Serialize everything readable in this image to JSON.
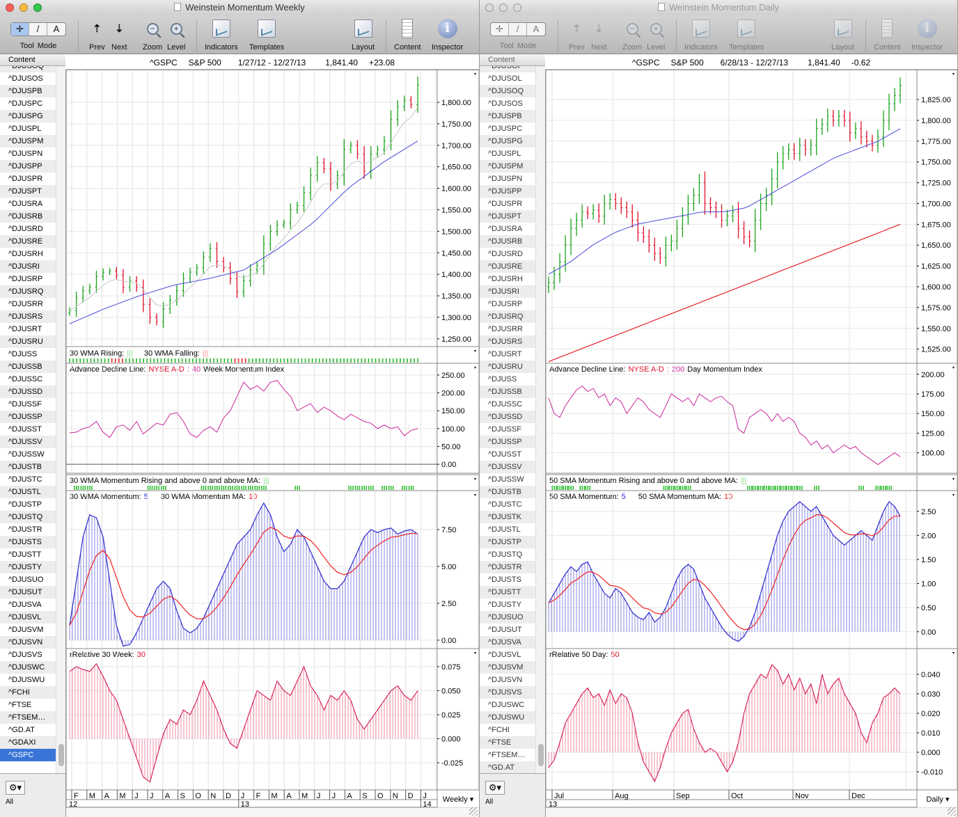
{
  "windows": [
    {
      "title": "Weinstein Momentum Weekly",
      "toolbar": {
        "tool_mode": "Tool Mode",
        "tool_cross": "✛",
        "tool_line": "/",
        "tool_text": "A",
        "prev": "Prev",
        "next": "Next",
        "zoom": "Zoom",
        "level": "Level",
        "indicators": "Indicators",
        "templates": "Templates",
        "layout": "Layout",
        "content": "Content",
        "inspector": "Inspector"
      },
      "sidebar": {
        "header": "Content",
        "filter": "All",
        "selected": "^GSPC",
        "items": [
          "^DJUSOQ",
          "^DJUSOS",
          "^DJUSPB",
          "^DJUSPC",
          "^DJUSPG",
          "^DJUSPL",
          "^DJUSPM",
          "^DJUSPN",
          "^DJUSPP",
          "^DJUSPR",
          "^DJUSPT",
          "^DJUSRA",
          "^DJUSRB",
          "^DJUSRD",
          "^DJUSRE",
          "^DJUSRH",
          "^DJUSRI",
          "^DJUSRP",
          "^DJUSRQ",
          "^DJUSRR",
          "^DJUSRS",
          "^DJUSRT",
          "^DJUSRU",
          "^DJUSS",
          "^DJUSSB",
          "^DJUSSC",
          "^DJUSSD",
          "^DJUSSF",
          "^DJUSSP",
          "^DJUSST",
          "^DJUSSV",
          "^DJUSSW",
          "^DJUSTB",
          "^DJUSTC",
          "^DJUSTL",
          "^DJUSTP",
          "^DJUSTQ",
          "^DJUSTR",
          "^DJUSTS",
          "^DJUSTT",
          "^DJUSTY",
          "^DJUSUO",
          "^DJUSUT",
          "^DJUSVA",
          "^DJUSVL",
          "^DJUSVM",
          "^DJUSVN",
          "^DJUSVS",
          "^DJUSWC",
          "^DJUSWU",
          "^FCHI",
          "^FTSE",
          "^FTSEM…",
          "^GD.AT",
          "^GDAXI",
          "^GSPC"
        ]
      },
      "header": {
        "symbol": "^GSPC",
        "name": "S&P 500",
        "range": "1/27/12 - 12/27/13",
        "last": "1,841.40",
        "change": "+23.08"
      },
      "legends": {
        "trend": {
          "rising_label": "30 WMA Rising:",
          "rising_mark": "|||",
          "falling_label": "30 WMA Falling:",
          "falling_mark": "|||"
        },
        "ad": {
          "label": "Advance Decline Line:",
          "series": "NYSE A-D",
          "sep": ":",
          "period": "40",
          "index": "Week Momentum Index"
        },
        "momrise": {
          "label": "30 WMA Momentum Rising and above 0 and above MA:",
          "mark": "|||"
        },
        "mom": {
          "label": "30 WMA Momentum:",
          "period": "5",
          "ma_label": "30 WMA Momentum MA:",
          "ma_period": "10"
        },
        "rel": {
          "label": "rRelative 30 Week:",
          "period": "30"
        }
      },
      "periodicity": "Weekly",
      "x_axis": {
        "months": [
          "F",
          "M",
          "A",
          "M",
          "J",
          "J",
          "A",
          "S",
          "O",
          "N",
          "D",
          "J",
          "F",
          "M",
          "A",
          "M",
          "J",
          "J",
          "A",
          "S",
          "O",
          "N",
          "D",
          "J"
        ],
        "years": [
          {
            "label": "12",
            "month": 0
          },
          {
            "label": "13",
            "month": 11
          },
          {
            "label": "14",
            "month": 23
          }
        ]
      }
    },
    {
      "title": "Weinstein Momentum Daily",
      "toolbar": {
        "tool_mode": "Tool Mode",
        "tool_cross": "✛",
        "tool_line": "/",
        "tool_text": "A",
        "prev": "Prev",
        "next": "Next",
        "zoom": "Zoom",
        "level": "Level",
        "indicators": "Indicators",
        "templates": "Templates",
        "layout": "Layout",
        "content": "Content",
        "inspector": "Inspector"
      },
      "sidebar": {
        "header": "Content",
        "filter": "All",
        "selected": "",
        "items": [
          "^DJUSOI",
          "^DJUSOL",
          "^DJUSOQ",
          "^DJUSOS",
          "^DJUSPB",
          "^DJUSPC",
          "^DJUSPG",
          "^DJUSPL",
          "^DJUSPM",
          "^DJUSPN",
          "^DJUSPP",
          "^DJUSPR",
          "^DJUSPT",
          "^DJUSRA",
          "^DJUSRB",
          "^DJUSRD",
          "^DJUSRE",
          "^DJUSRH",
          "^DJUSRI",
          "^DJUSRP",
          "^DJUSRQ",
          "^DJUSRR",
          "^DJUSRS",
          "^DJUSRT",
          "^DJUSRU",
          "^DJUSS",
          "^DJUSSB",
          "^DJUSSC",
          "^DJUSSD",
          "^DJUSSF",
          "^DJUSSP",
          "^DJUSST",
          "^DJUSSV",
          "^DJUSSW",
          "^DJUSTB",
          "^DJUSTC",
          "^DJUSTK",
          "^DJUSTL",
          "^DJUSTP",
          "^DJUSTQ",
          "^DJUSTR",
          "^DJUSTS",
          "^DJUSTT",
          "^DJUSTY",
          "^DJUSUO",
          "^DJUSUT",
          "^DJUSVA",
          "^DJUSVL",
          "^DJUSVM",
          "^DJUSVN",
          "^DJUSVS",
          "^DJUSWC",
          "^DJUSWU",
          "^FCHI",
          "^FTSE",
          "^FTSEM…",
          "^GD.AT"
        ]
      },
      "header": {
        "symbol": "^GSPC",
        "name": "S&P 500",
        "range": "6/28/13 - 12/27/13",
        "last": "1,841.40",
        "change": "-0.62"
      },
      "legends": {
        "ad": {
          "label": "Advance Decline Line:",
          "series": "NYSE A-D",
          "sep": ":",
          "period": "200",
          "index": "Day Momentum Index"
        },
        "momrise": {
          "label": "50 SMA Momentum Rising and above 0 and above MA:",
          "mark": "|||"
        },
        "mom": {
          "label": "50 SMA Momentum:",
          "period": "5",
          "ma_label": "50 SMA Momentum MA:",
          "ma_period": "10"
        },
        "rel": {
          "label": "rRelative 50 Day:",
          "period": "50"
        }
      },
      "periodicity": "Daily",
      "x_axis": {
        "months": [
          "Jul",
          "Aug",
          "Sep",
          "Oct",
          "Nov",
          "Dec"
        ],
        "years": [
          {
            "label": "13",
            "month": 0
          }
        ]
      }
    }
  ],
  "colors": {
    "up": "#1aa31a",
    "down": "#e0102a",
    "ma_fast": "#c8c8c8",
    "ma_slow": "#4a4adc",
    "ma_long": "#e8202a",
    "ad_line": "#c8289a",
    "momentum": "#2a2ad0",
    "momentum_ma": "#f02020",
    "relative": "#d81850",
    "rising": "#22bb22",
    "falling": "#ee2222"
  },
  "chart_data": [
    {
      "type": "line",
      "title": "^GSPC S&P 500 Weekly",
      "x_range": [
        "1/27/12",
        "12/27/13"
      ],
      "price": {
        "ylim": [
          1232,
          1876
        ],
        "ticks": [
          1250,
          1300,
          1350,
          1400,
          1450,
          1500,
          1550,
          1600,
          1650,
          1700,
          1750,
          1800
        ],
        "close": [
          1316,
          1345,
          1362,
          1370,
          1395,
          1405,
          1408,
          1398,
          1370,
          1385,
          1370,
          1330,
          1300,
          1290,
          1320,
          1340,
          1362,
          1390,
          1405,
          1415,
          1440,
          1460,
          1430,
          1415,
          1390,
          1360,
          1385,
          1410,
          1420,
          1470,
          1500,
          1515,
          1520,
          1550,
          1560,
          1590,
          1630,
          1660,
          1645,
          1610,
          1630,
          1690,
          1700,
          1680,
          1640,
          1680,
          1690,
          1710,
          1760,
          1790,
          1805,
          1795,
          1840
        ],
        "ma_slow": [
          1285,
          1320,
          1350,
          1375,
          1390,
          1410,
          1460,
          1520,
          1600,
          1660,
          1710
        ]
      },
      "trend": {
        "bars": 100,
        "falling": [
          [
            12,
            15
          ],
          [
            47,
            50
          ]
        ]
      },
      "ad": {
        "ylim": [
          -25,
          283
        ],
        "ticks": [
          0,
          50,
          100,
          150,
          200,
          250
        ],
        "values": [
          88,
          90,
          100,
          105,
          120,
          90,
          75,
          105,
          110,
          95,
          120,
          85,
          100,
          115,
          110,
          140,
          145,
          120,
          85,
          75,
          95,
          105,
          90,
          130,
          150,
          190,
          230,
          210,
          220,
          205,
          230,
          235,
          210,
          190,
          150,
          160,
          170,
          145,
          160,
          150,
          135,
          125,
          140,
          130,
          120,
          115,
          100,
          110,
          100,
          105,
          80,
          95,
          100
        ]
      },
      "momentum": {
        "ylim": [
          -0.57,
          10.14
        ],
        "ticks": [
          0,
          2.5,
          5,
          7.5
        ],
        "decimals": 2,
        "values": [
          1,
          4,
          7,
          8.5,
          8.3,
          7,
          4,
          1,
          -0.4,
          -0.3,
          0.5,
          1.5,
          2.5,
          3.5,
          4,
          3.5,
          2,
          0.8,
          0.5,
          0.8,
          1.5,
          2.5,
          3.5,
          4.5,
          5.5,
          6.5,
          7,
          7.5,
          8.5,
          9.3,
          8.5,
          7,
          6,
          6.5,
          7.5,
          7,
          6,
          5,
          4,
          3.5,
          3.5,
          4,
          5,
          6,
          7,
          7.5,
          7.3,
          7.5,
          7.6,
          7.2,
          7.4,
          7.5,
          7.2
        ]
      },
      "relative": {
        "ylim": [
          -0.0533,
          0.0938
        ],
        "ticks": [
          -0.025,
          0,
          0.025,
          0.05,
          0.075
        ],
        "decimals": 3,
        "values": [
          0.07,
          0.075,
          0.072,
          0.07,
          0.078,
          0.065,
          0.05,
          0.04,
          0.02,
          0.0,
          -0.02,
          -0.04,
          -0.045,
          -0.02,
          0.005,
          0.02,
          0.015,
          0.03,
          0.025,
          0.04,
          0.06,
          0.045,
          0.03,
          0.01,
          -0.005,
          -0.01,
          0.01,
          0.03,
          0.05,
          0.045,
          0.04,
          0.06,
          0.05,
          0.045,
          0.06,
          0.075,
          0.055,
          0.045,
          0.03,
          0.045,
          0.04,
          0.05,
          0.04,
          0.02,
          0.01,
          0.02,
          0.03,
          0.04,
          0.05,
          0.055,
          0.045,
          0.04,
          0.05
        ]
      }
    },
    {
      "type": "line",
      "title": "^GSPC S&P 500 Daily",
      "x_range": [
        "6/28/13",
        "12/27/13"
      ],
      "price": {
        "ylim": [
          1508,
          1861
        ],
        "ticks": [
          1525,
          1550,
          1575,
          1600,
          1625,
          1650,
          1675,
          1700,
          1725,
          1750,
          1775,
          1800,
          1825
        ],
        "close": [
          1605,
          1615,
          1630,
          1650,
          1670,
          1680,
          1690,
          1688,
          1692,
          1685,
          1700,
          1705,
          1700,
          1695,
          1690,
          1680,
          1665,
          1660,
          1650,
          1640,
          1635,
          1650,
          1655,
          1670,
          1685,
          1700,
          1710,
          1725,
          1700,
          1695,
          1690,
          1680,
          1685,
          1690,
          1670,
          1660,
          1655,
          1680,
          1700,
          1710,
          1730,
          1750,
          1760,
          1765,
          1760,
          1770,
          1765,
          1770,
          1790,
          1795,
          1805,
          1800,
          1805,
          1800,
          1785,
          1790,
          1780,
          1775,
          1770,
          1780,
          1800,
          1820,
          1830,
          1842
        ],
        "ma_slow": [
          1615,
          1630,
          1650,
          1665,
          1675,
          1680,
          1685,
          1690,
          1690,
          1695,
          1710,
          1725,
          1740,
          1755,
          1765,
          1775,
          1790
        ],
        "ma_long": [
          1510,
          1675
        ]
      },
      "ad": {
        "ylim": [
          74,
          214
        ],
        "ticks": [
          100,
          125,
          150,
          175,
          200
        ],
        "values": [
          170,
          150,
          145,
          160,
          170,
          180,
          185,
          178,
          182,
          170,
          175,
          160,
          170,
          165,
          150,
          160,
          170,
          165,
          155,
          150,
          145,
          160,
          175,
          170,
          165,
          170,
          160,
          175,
          170,
          165,
          170,
          172,
          165,
          160,
          130,
          125,
          145,
          150,
          155,
          150,
          140,
          150,
          140,
          145,
          140,
          125,
          120,
          110,
          115,
          105,
          110,
          100,
          105,
          110,
          105,
          108,
          100,
          95,
          90,
          85,
          90,
          95,
          100,
          95
        ]
      },
      "momentum": {
        "ylim": [
          -0.35,
          2.93
        ],
        "ticks": [
          0,
          0.5,
          1,
          1.5,
          2,
          2.5
        ],
        "decimals": 2,
        "values": [
          0.6,
          0.8,
          1.0,
          1.2,
          1.35,
          1.25,
          1.4,
          1.45,
          1.2,
          1.0,
          0.8,
          0.7,
          0.9,
          0.8,
          0.6,
          0.4,
          0.3,
          0.25,
          0.4,
          0.2,
          0.3,
          0.5,
          0.8,
          1.1,
          1.3,
          1.4,
          1.3,
          1.0,
          0.7,
          0.5,
          0.3,
          0.1,
          -0.05,
          -0.15,
          -0.2,
          -0.1,
          0.1,
          0.4,
          0.8,
          1.2,
          1.6,
          2.0,
          2.3,
          2.5,
          2.6,
          2.7,
          2.6,
          2.5,
          2.6,
          2.4,
          2.2,
          2.0,
          1.9,
          1.8,
          1.9,
          2.0,
          2.1,
          2.0,
          1.9,
          2.2,
          2.5,
          2.7,
          2.6,
          2.4
        ]
      },
      "relative": {
        "ylim": [
          -0.0193,
          0.0532
        ],
        "ticks": [
          -0.01,
          0,
          0.01,
          0.02,
          0.03,
          0.04
        ],
        "decimals": 3,
        "values": [
          -0.008,
          -0.004,
          0.005,
          0.015,
          0.02,
          0.025,
          0.03,
          0.033,
          0.028,
          0.03,
          0.024,
          0.032,
          0.025,
          0.03,
          0.028,
          0.02,
          0.005,
          -0.005,
          -0.01,
          -0.015,
          -0.008,
          0.002,
          0.01,
          0.015,
          0.02,
          0.022,
          0.012,
          0.005,
          0.0,
          0.002,
          0.0,
          -0.005,
          -0.01,
          -0.005,
          0.005,
          0.02,
          0.03,
          0.035,
          0.04,
          0.038,
          0.045,
          0.042,
          0.035,
          0.04,
          0.032,
          0.038,
          0.03,
          0.035,
          0.025,
          0.04,
          0.03,
          0.035,
          0.038,
          0.03,
          0.025,
          0.02,
          0.01,
          0.005,
          0.015,
          0.02,
          0.028,
          0.03,
          0.033,
          0.03
        ]
      }
    }
  ]
}
